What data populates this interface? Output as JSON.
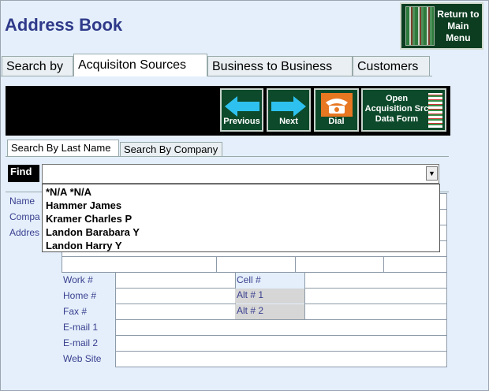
{
  "title": "Address Book",
  "return_button": {
    "label_line1": "Return to",
    "label_line2": "Main",
    "label_line3": "Menu"
  },
  "tabs": [
    "Search by",
    "Acquisiton Sources",
    "Business to Business",
    "Customers"
  ],
  "toolbar": {
    "previous": "Previous",
    "next": "Next",
    "dial": "Dial",
    "open_form_line1": "Open",
    "open_form_line2": "Acquisition Src",
    "open_form_line3": "Data  Form"
  },
  "search_tabs": [
    "Search By Last Name",
    "Search By Company"
  ],
  "find_label": "Find",
  "dropdown_items": [
    "*N/A *N/A",
    "Hammer James",
    "Kramer Charles P",
    "Landon Barabara Y",
    "Landon Harry Y"
  ],
  "labels": {
    "name": "Name",
    "company": "Compa",
    "address": "Addres",
    "work": "Work #",
    "home": "Home #",
    "fax": "Fax #",
    "email1": "E-mail 1",
    "email2": "E-mail  2",
    "website": "Web Site",
    "cell": "Cell #",
    "alt1": "Alt # 1",
    "alt2": "Alt # 2"
  }
}
